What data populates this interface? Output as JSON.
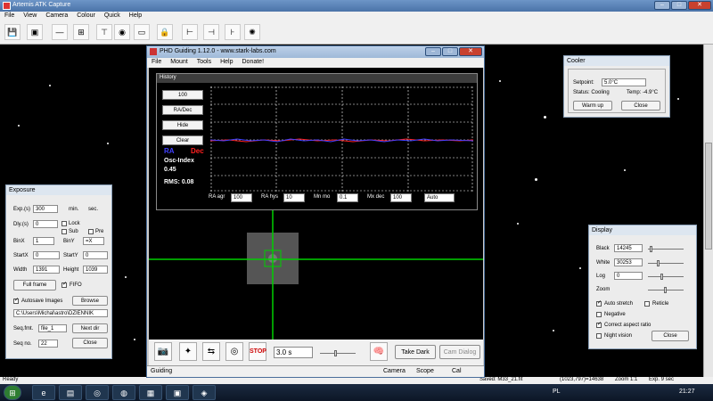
{
  "window": {
    "title": "Artemis ATK Capture"
  },
  "menu": [
    "File",
    "View",
    "Camera",
    "Colour",
    "Quick",
    "Help"
  ],
  "status": {
    "left": "Ready",
    "saved": "Saved: M33_21.fit",
    "coords": "(1023,797)=14638",
    "zoom": "Zoom 1:1",
    "exp": "Exp. 9 sec"
  },
  "phd": {
    "title": "PHD Guiding 1.12.0  -  www.stark-labs.com",
    "menu": [
      "File",
      "Mount",
      "Tools",
      "Help",
      "Donate!"
    ],
    "history": {
      "title": "History",
      "btn_100": "100",
      "btn_radec": "RA/Dec",
      "btn_hide": "Hide",
      "btn_clear": "Clear",
      "ra_label": "RA",
      "dec_label": "Dec",
      "osc_label": "Osc-Index",
      "osc_value": "0.45",
      "rms": "RMS: 0.08"
    },
    "controls": {
      "ra_agr_label": "RA agr",
      "ra_agr": "100",
      "ra_hys_label": "RA hys",
      "ra_hys": "10",
      "mn_mo_label": "Mn mo",
      "mn_mo": "0.1",
      "mx_dec_label": "Mx dec",
      "mx_dec": "100",
      "mode": "Auto"
    },
    "tools": {
      "exposure": "3.0 s",
      "take_dark": "Take Dark",
      "cam_dialog": "Cam Dialog"
    },
    "statusbar": {
      "guiding": "Guiding",
      "camera": "Camera",
      "scope": "Scope",
      "cal": "Cal"
    }
  },
  "exposure": {
    "title": "Exposure",
    "exp_label": "Exp.(s)",
    "exp": "300",
    "min_label": "min.",
    "sec_label": "sec.",
    "dly_label": "Dly.(s)",
    "dly": "0",
    "lock_label": "Lock",
    "sub_label": "Sub",
    "pre_label": "Pre",
    "binx_label": "BinX",
    "binx": "1",
    "biny_label": "BinY",
    "biny": "=X",
    "startx_label": "StartX",
    "startx": "0",
    "starty_label": "StartY",
    "starty": "0",
    "width_label": "Width",
    "width": "1391",
    "height_label": "Height",
    "height": "1039",
    "full_frame": "Full frame",
    "fifo": "FIFO",
    "autosave": "Autosave Images",
    "browse": "Browse",
    "path": "C:\\Users\\Michal\\astro\\DZIENNIK",
    "seqfmt_label": "Seq.fmt.",
    "seqfmt": "file_1",
    "next_dir": "Next dir",
    "seqno_label": "Seq no.",
    "seqno": "22",
    "close": "Close"
  },
  "cooler": {
    "title": "Cooler",
    "setpoint_label": "Setpoint:",
    "setpoint": "5.0°C",
    "status": "Status: Cooling",
    "temp": "Temp: -4.9°C",
    "warm_up": "Warm up",
    "close": "Close"
  },
  "display": {
    "title": "Display",
    "black_label": "Black",
    "black": "14245",
    "white_label": "White",
    "white": "30253",
    "log_label": "Log",
    "log": "0",
    "zoom_label": "Zoom",
    "auto_stretch": "Auto stretch",
    "reticle": "Reticle",
    "negative": "Negative",
    "aspect": "Correct aspect ratio",
    "night": "Night vision",
    "close": "Close"
  },
  "taskbar": {
    "lang": "PL",
    "time": "21:27"
  },
  "colors": {
    "ra": "#4040ff",
    "dec": "#ff2020",
    "crosshair": "#00d000"
  }
}
